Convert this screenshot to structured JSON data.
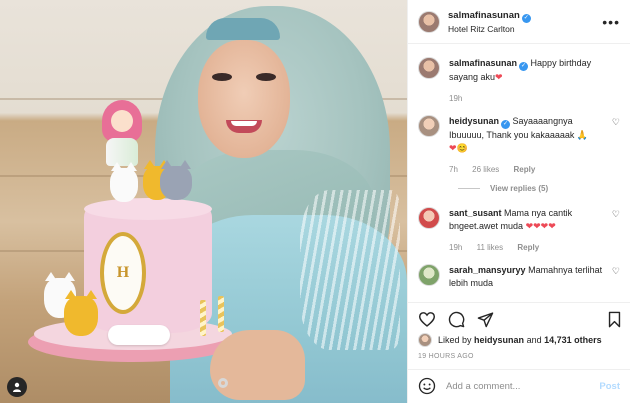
{
  "header": {
    "username": "salmafinasunan",
    "location": "Hotel Ritz Carlton",
    "more_icon": "ellipsis-icon"
  },
  "photo": {
    "cake_monogram": "H",
    "user_tag_icon": "person-icon"
  },
  "caption": {
    "username": "salmafinasunan",
    "text": "Happy birthday sayang aku",
    "emoji": "❤",
    "time": "19h"
  },
  "comments": [
    {
      "username": "heidysunan",
      "verified": true,
      "text": "Sayaaaangnya Ibuuuuu, Thank you kakaaaaak 🙏",
      "emoji": "❤😊",
      "time": "7h",
      "likes": "26 likes",
      "reply": "Reply",
      "view_replies": "View replies (5)"
    },
    {
      "username": "sant_susant",
      "text": "Mama nya cantik bngeet.awet muda",
      "emoji": "❤❤❤❤",
      "time": "19h",
      "likes": "11 likes",
      "reply": "Reply"
    },
    {
      "username": "sarah_mansyuryy",
      "text": "Mamahnya terlihat lebih muda"
    }
  ],
  "actions": {
    "like_icon": "heart-icon",
    "comment_icon": "comment-icon",
    "share_icon": "paper-plane-icon",
    "save_icon": "bookmark-icon"
  },
  "likes": {
    "prefix": "Liked by",
    "user": "heidysunan",
    "and": "and",
    "count": "14,731 others"
  },
  "timestamp": "19 HOURS AGO",
  "add_comment": {
    "placeholder": "Add a comment...",
    "post_label": "Post",
    "emoji_icon": "smiley-icon"
  },
  "colors": {
    "link_blue": "#3897f0",
    "post_disabled": "#b3dbff",
    "heart_red": "#ed4956",
    "muted": "#8e8e8e"
  }
}
